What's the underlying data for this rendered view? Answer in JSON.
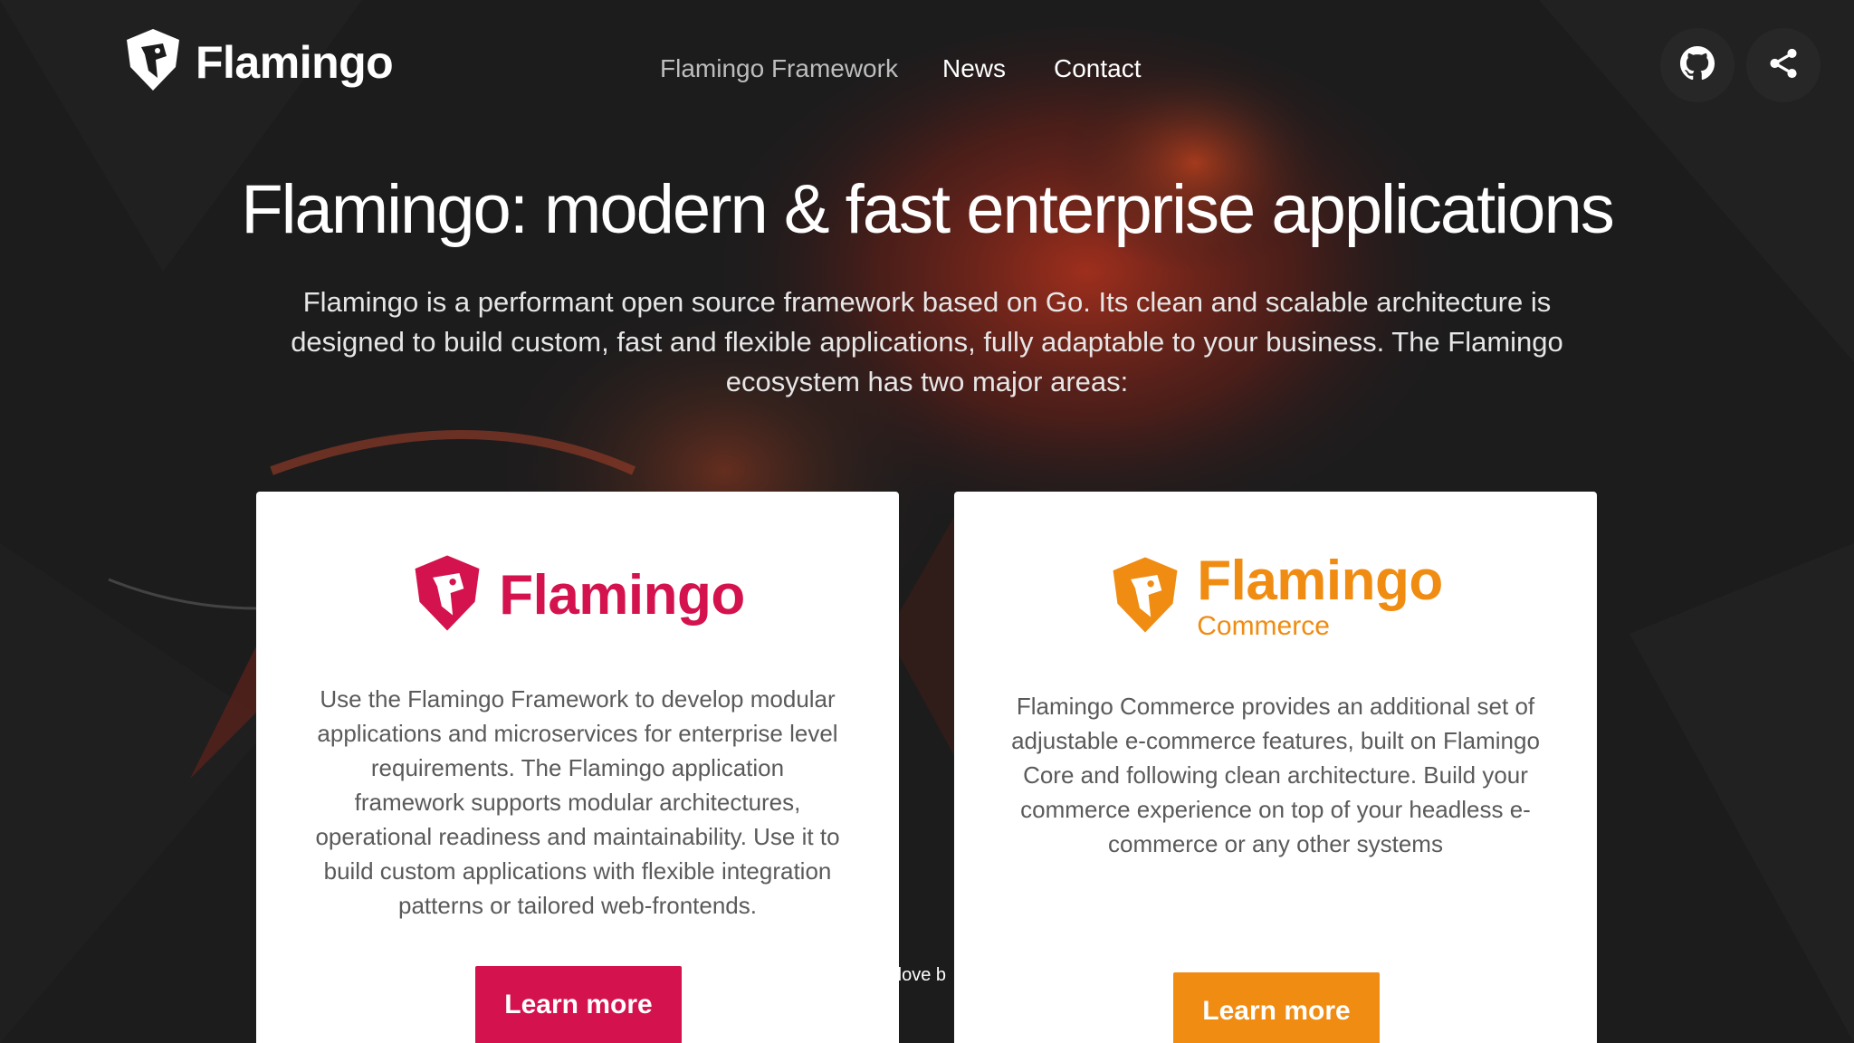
{
  "header": {
    "brand": "Flamingo",
    "nav": [
      {
        "label": "Flamingo Framework",
        "active": true
      },
      {
        "label": "News",
        "active": false
      },
      {
        "label": "Contact",
        "active": false
      }
    ],
    "icons": [
      "github-icon",
      "share-icon"
    ]
  },
  "hero": {
    "title": "Flamingo: modern & fast enterprise applications",
    "subtitle": "Flamingo is a performant open source framework based on Go. Its clean and scalable architecture is designed to build custom, fast and flexible applications, fully adaptable to your business. The Flamingo ecosystem has two major areas:"
  },
  "cards": {
    "framework": {
      "logo_text": "Flamingo",
      "description": "Use the Flamingo Framework to develop modular applications and microservices for enterprise level requirements. The Flamingo application framework supports modular architectures, operational readiness and maintainability. Use it to build custom applications with flexible integration patterns or tailored web-frontends.",
      "button": "Learn more",
      "accent": "#d4124e"
    },
    "commerce": {
      "logo_text": "Flamingo",
      "logo_sub": "Commerce",
      "description": "Flamingo Commerce provides an additional set of adjustable e-commerce features, built on Flamingo Core and following clean architecture. Build your commerce experience on top of your headless e-commerce or any other systems",
      "button": "Learn more",
      "accent": "#f08c12"
    }
  },
  "footer_peek": "n love b"
}
